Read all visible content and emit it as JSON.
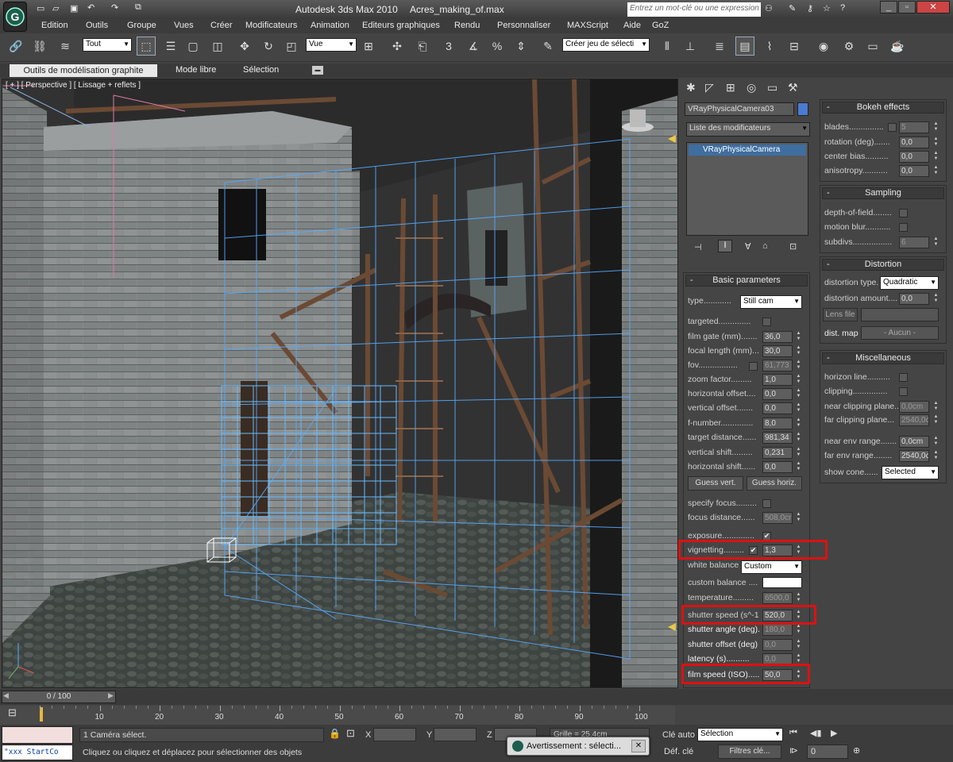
{
  "titlebar": {
    "app_title": "Autodesk 3ds Max  2010",
    "file_name": "Acres_making_of.max",
    "search_placeholder": "Entrez un mot-clé ou une expression"
  },
  "menu": [
    "Edition",
    "Outils",
    "Groupe",
    "Vues",
    "Créer",
    "Modificateurs",
    "Animation",
    "Editeurs graphiques",
    "Rendu",
    "Personnaliser",
    "MAXScript",
    "Aide",
    "GoZ"
  ],
  "toolbar": {
    "selection_filter": "Tout",
    "ref_coord": "Vue",
    "named_selection": "Créer jeu de sélecti",
    "snap_label": "3"
  },
  "ribbon": {
    "tabs": [
      "Outils de modélisation graphite",
      "Mode libre",
      "Sélection"
    ]
  },
  "viewport": {
    "label": "[ + ] [ Perspective ] [ Lissage + reflets ]"
  },
  "cmdpanel": {
    "object_name": "VRayPhysicalCamera03",
    "object_color": "#4a7bd0",
    "modifier_list": "Liste des modificateurs",
    "stack_item": "VRayPhysicalCamera"
  },
  "basic": {
    "title": "Basic parameters",
    "type_label": "type............",
    "type_value": "Still cam",
    "targeted": "targeted..............",
    "film_gate_label": "film gate (mm).......",
    "film_gate": "36,0",
    "focal_label": "focal length (mm)...",
    "focal": "30,0",
    "fov_label": "fov.................",
    "fov": "61,773",
    "zoom_label": "zoom factor.........",
    "zoom": "1,0",
    "hoff_label": "horizontal offset....",
    "hoff": "0,0",
    "voff_label": "vertical offset.......",
    "voff": "0,0",
    "fnum_label": "f-number..............",
    "fnum": "8,0",
    "tdist_label": "target distance......",
    "tdist": "981,34",
    "vshift_label": "vertical shift.........",
    "vshift": "0,231",
    "hshift_label": "horizontal shift......",
    "hshift": "0,0",
    "guess_vert": "Guess vert.",
    "guess_horiz": "Guess horiz.",
    "specify_focus": "specify focus.........",
    "focus_dist_label": "focus distance......",
    "focus_dist": "508,0cr",
    "exposure": "exposure..............",
    "vignetting_label": "vignetting.........",
    "vignetting": "1,3",
    "wb_label": "white balance",
    "wb_value": "Custom",
    "custom_balance": "custom balance ....",
    "temperature_label": "temperature.........",
    "temperature": "6500,0",
    "shutter_speed_label": "shutter speed (s^-1",
    "shutter_speed": "520,0",
    "shutter_angle_label": "shutter angle (deg).",
    "shutter_angle": "180,0",
    "shutter_offset_label": "shutter offset (deg)",
    "shutter_offset": "0,0",
    "latency_label": "latency (s)..........",
    "latency": "0,0",
    "iso_label": "film speed (ISO).....",
    "iso": "50,0"
  },
  "bokeh": {
    "title": "Bokeh effects",
    "blades_label": "blades...............",
    "blades": "5",
    "rotation_label": "rotation (deg).......",
    "rotation": "0,0",
    "center_bias_label": "center bias..........",
    "center_bias": "0,0",
    "anisotropy_label": "anisotropy...........",
    "anisotropy": "0,0"
  },
  "sampling": {
    "title": "Sampling",
    "dof": "depth-of-field........",
    "motion_blur": "motion blur...........",
    "subdivs_label": "subdivs.................",
    "subdivs": "6"
  },
  "distortion": {
    "title": "Distortion",
    "type_label": "distortion type.",
    "type_value": "Quadratic",
    "amount_label": "distortion amount....",
    "amount": "0,0",
    "lens_file": "Lens file",
    "dist_map": "dist. map",
    "dist_map_value": "- Aucun -"
  },
  "misc": {
    "title": "Miscellaneous",
    "horizon": "horizon line..........",
    "clipping": "clipping...............",
    "near_clip_label": "near clipping plane..",
    "near_clip": "0,0cm",
    "far_clip_label": "far clipping plane...",
    "far_clip": "2540,0c",
    "near_env_label": "near env range.......",
    "near_env": "0,0cm",
    "far_env_label": "far env range........",
    "far_env": "2540,0c",
    "show_cone_label": "show cone......",
    "show_cone": "Selected"
  },
  "timeline": {
    "frame": "0 / 100",
    "ticks": [
      "0",
      "10",
      "20",
      "30",
      "40",
      "50",
      "60",
      "70",
      "80",
      "90",
      "100"
    ]
  },
  "status": {
    "script": "\"xxx StartCo",
    "selected": "1 Caméra sélect.",
    "prompt": "Cliquez ou cliquez et déplacez pour sélectionner des objets",
    "x_label": "X",
    "y_label": "Y",
    "z_label": "Z",
    "grid": "Grille = 25,4cm",
    "cle_auto": "Clé auto",
    "def_cle": "Déf. clé",
    "selection_set": "Sélection",
    "filtres": "Filtres clé...",
    "frame_field": "0",
    "warning": "Avertissement : sélecti..."
  },
  "colors": {
    "highlight_red": "#dd1111",
    "wireframe": "#55aaff"
  }
}
